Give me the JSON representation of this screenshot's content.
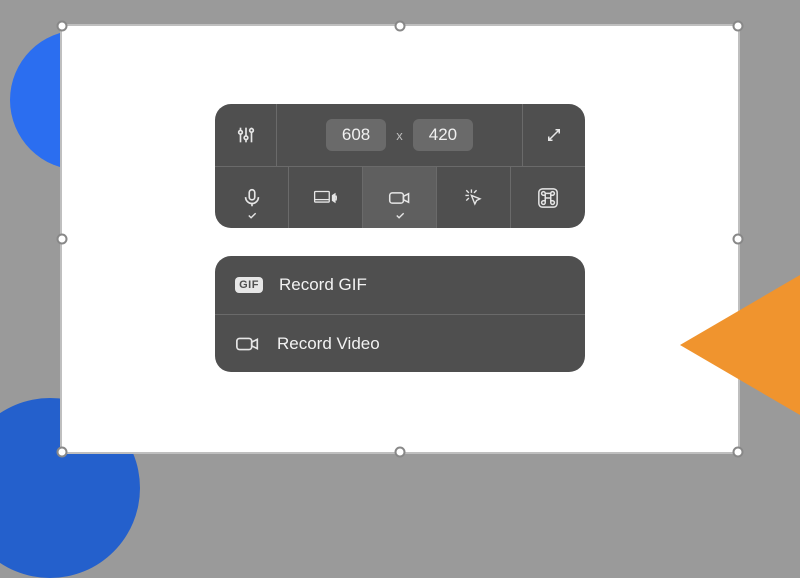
{
  "dimensions": {
    "width": "608",
    "height": "420",
    "separator": "x"
  },
  "record": {
    "gif_badge": "GIF",
    "gif_label": "Record GIF",
    "video_label": "Record Video"
  }
}
